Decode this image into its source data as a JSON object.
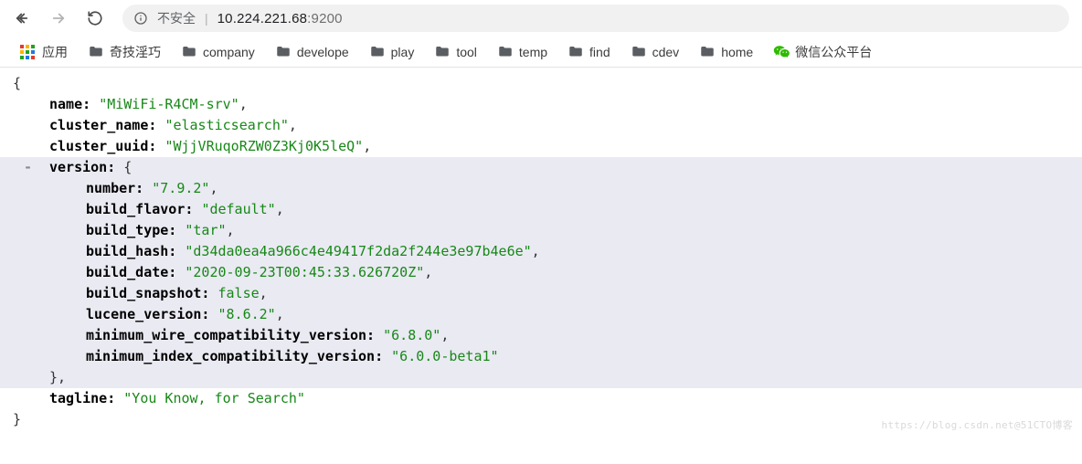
{
  "nav": {
    "insecure_label": "不安全",
    "host": "10.224.221.68",
    "port": ":9200"
  },
  "bookmarks": {
    "apps_label": "应用",
    "items": [
      {
        "label": "奇技淫巧"
      },
      {
        "label": "company"
      },
      {
        "label": "develope"
      },
      {
        "label": "play"
      },
      {
        "label": "tool"
      },
      {
        "label": "temp"
      },
      {
        "label": "find"
      },
      {
        "label": "cdev"
      },
      {
        "label": "home"
      }
    ],
    "wechat_label": "微信公众平台"
  },
  "json": {
    "brace_open": "{",
    "brace_close": "}",
    "inner_brace_close": "},",
    "toggle": "-",
    "name": {
      "k": "name:",
      "v": "\"MiWiFi-R4CM-srv\"",
      "c": ","
    },
    "cluster_name": {
      "k": "cluster_name:",
      "v": "\"elasticsearch\"",
      "c": ","
    },
    "cluster_uuid": {
      "k": "cluster_uuid:",
      "v": "\"WjjVRuqoRZW0Z3Kj0K5leQ\"",
      "c": ","
    },
    "version_key": {
      "k": "version:",
      "open": " {"
    },
    "number": {
      "k": "number:",
      "v": "\"7.9.2\"",
      "c": ","
    },
    "build_flavor": {
      "k": "build_flavor:",
      "v": "\"default\"",
      "c": ","
    },
    "build_type": {
      "k": "build_type:",
      "v": "\"tar\"",
      "c": ","
    },
    "build_hash": {
      "k": "build_hash:",
      "v": "\"d34da0ea4a966c4e49417f2da2f244e3e97b4e6e\"",
      "c": ","
    },
    "build_date": {
      "k": "build_date:",
      "v": "\"2020-09-23T00:45:33.626720Z\"",
      "c": ","
    },
    "build_snapshot": {
      "k": "build_snapshot:",
      "v": "false",
      "c": ","
    },
    "lucene_version": {
      "k": "lucene_version:",
      "v": "\"8.6.2\"",
      "c": ","
    },
    "mwcv": {
      "k": "minimum_wire_compatibility_version:",
      "v": "\"6.8.0\"",
      "c": ","
    },
    "micv": {
      "k": "minimum_index_compatibility_version:",
      "v": "\"6.0.0-beta1\"",
      "c": ""
    },
    "tagline": {
      "k": "tagline:",
      "v": "\"You Know, for Search\"",
      "c": ""
    }
  },
  "watermark": "https://blog.csdn.net@51CTO博客"
}
